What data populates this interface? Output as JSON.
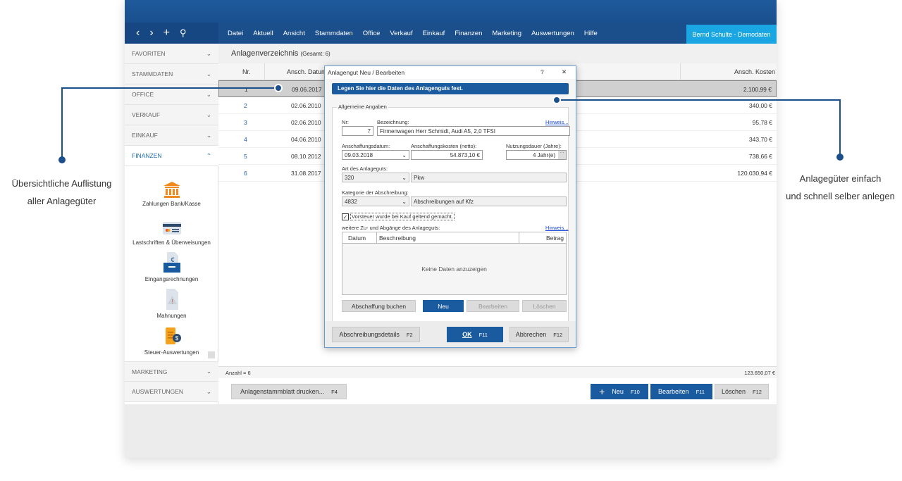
{
  "nav": {
    "menu": [
      "Datei",
      "Aktuell",
      "Ansicht",
      "Stammdaten",
      "Office",
      "Verkauf",
      "Einkauf",
      "Finanzen",
      "Marketing",
      "Auswertungen",
      "Hilfe"
    ],
    "user": "Bernd Schulte - Demodaten"
  },
  "sidebar": {
    "sections": [
      "FAVORITEN",
      "STAMMDATEN",
      "OFFICE",
      "VERKAUF",
      "EINKAUF",
      "FINANZEN"
    ],
    "bottom_sections": [
      "MARKETING",
      "AUSWERTUNGEN"
    ],
    "launchers": [
      "Zahlungen Bank/Kasse",
      "Lastschriften & Überweisungen",
      "Eingangsrechnungen",
      "Mahnungen",
      "Steuer-Auswertungen"
    ]
  },
  "main": {
    "title": "Anlagenverzeichnis",
    "subtitle": "(Gesamt: 6)",
    "columns": [
      "Nr.",
      "Ansch. Datum",
      "Ansch. Kosten"
    ],
    "rows": [
      [
        "1",
        "09.06.2017",
        "2.100,99 €"
      ],
      [
        "2",
        "02.06.2010",
        "340,00 €"
      ],
      [
        "3",
        "02.06.2010",
        "95,78 €"
      ],
      [
        "4",
        "04.06.2010",
        "343,70 €"
      ],
      [
        "5",
        "08.10.2012",
        "738,66 €"
      ],
      [
        "6",
        "31.08.2017",
        "120.030,94 €"
      ]
    ],
    "count": "Anzahl = 6",
    "total": "123.650,07 €",
    "buttons": {
      "print": "Anlagenstammblatt drucken...",
      "print_key": "F4",
      "new": "Neu",
      "new_key": "F10",
      "edit": "Bearbeiten",
      "edit_key": "F11",
      "delete": "Löschen",
      "delete_key": "F12"
    }
  },
  "dialog": {
    "title": "Anlagengut Neu / Bearbeiten",
    "help": "?",
    "close": "✕",
    "banner": "Legen Sie hier die Daten des Anlagenguts fest.",
    "group": "Allgemeine Angaben",
    "nr_label": "Nr:",
    "nr": "7",
    "bez_label": "Bezeichnung:",
    "bez": "Firmenwagen Herr Schmidt, Audi A5, 2,0 TFSI",
    "hint": "Hinweis...",
    "datum_label": "Anschaffungsdatum:",
    "datum": "09.03.2018",
    "kosten_label": "Anschaffungskosten (netto):",
    "kosten": "54.873,10 €",
    "dauer_label": "Nutzungsdauer (Jahre):",
    "dauer": "4 Jahr(e)",
    "art_label": "Art des Anlageguts:",
    "art_code": "320",
    "art": "Pkw",
    "kat_label": "Kategorie der Abschreibung:",
    "kat_code": "4832",
    "kat": "Abschreibungen auf Kfz",
    "vorsteuer": "Vorsteuer wurde bei Kauf geltend gemacht.",
    "weitere_label": "weitere Zu- und Abgänge des Anlageguts:",
    "grid_cols": [
      "Datum",
      "Beschreibung",
      "Betrag"
    ],
    "empty": "Keine Daten anzuzeigen",
    "btn_abschaffung": "Abschaffung buchen",
    "btn_neu": "Neu",
    "btn_bearbeiten": "Bearbeiten",
    "btn_loeschen": "Löschen",
    "btn_details": "Abschreibungsdetails",
    "details_key": "F2",
    "btn_ok": "OK",
    "ok_key": "F11",
    "btn_cancel": "Abbrechen",
    "cancel_key": "F12"
  },
  "annotations": {
    "left": [
      "Übersichtliche Auflistung",
      "aller Anlagegüter"
    ],
    "right": [
      "Anlagegüter einfach",
      "und schnell selber anlegen"
    ]
  },
  "colors": {
    "nav": "#1a4f8c",
    "user": "#19a6e3",
    "button_primary": "#1a5a9e"
  }
}
